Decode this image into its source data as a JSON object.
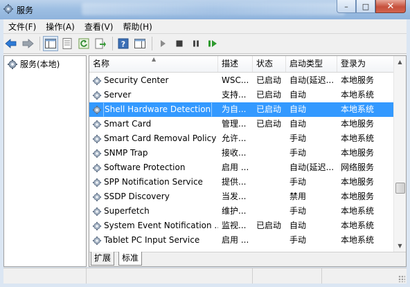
{
  "window": {
    "title": "服务",
    "minimize_glyph": "–",
    "maximize_glyph": "□",
    "close_glyph": "✕"
  },
  "menu": [
    {
      "label": "文件(F)"
    },
    {
      "label": "操作(A)"
    },
    {
      "label": "查看(V)"
    },
    {
      "label": "帮助(H)"
    }
  ],
  "toolbar": [
    {
      "icon": "back-arrow-icon"
    },
    {
      "icon": "forward-arrow-icon"
    },
    {
      "icon": "console-tree-icon"
    },
    {
      "icon": "properties-icon"
    },
    {
      "icon": "refresh-icon"
    },
    {
      "icon": "export-list-icon"
    },
    {
      "icon": "help-icon"
    },
    {
      "icon": "show-hide-action-pane-icon"
    },
    {
      "icon": "start-service-icon"
    },
    {
      "icon": "stop-service-icon"
    },
    {
      "icon": "pause-service-icon"
    },
    {
      "icon": "restart-service-icon"
    }
  ],
  "tree": {
    "root_label": "服务(本地)",
    "icon": "services-gear-icon"
  },
  "columns": [
    {
      "label": "名称",
      "width": 186
    },
    {
      "label": "描述",
      "width": 50
    },
    {
      "label": "状态",
      "width": 48
    },
    {
      "label": "启动类型",
      "width": 74
    },
    {
      "label": "登录为",
      "width": 83
    }
  ],
  "services": [
    {
      "name": "Security Center",
      "desc": "WSC...",
      "status": "已启动",
      "startup": "自动(延迟...",
      "logon": "本地服务",
      "selected": false
    },
    {
      "name": "Server",
      "desc": "支持...",
      "status": "已启动",
      "startup": "自动",
      "logon": "本地系统",
      "selected": false
    },
    {
      "name": "Shell Hardware Detection",
      "desc": "为自...",
      "status": "已启动",
      "startup": "自动",
      "logon": "本地系统",
      "selected": true
    },
    {
      "name": "Smart Card",
      "desc": "管理...",
      "status": "已启动",
      "startup": "自动",
      "logon": "本地服务",
      "selected": false
    },
    {
      "name": "Smart Card Removal Policy",
      "desc": "允许...",
      "status": "",
      "startup": "手动",
      "logon": "本地系统",
      "selected": false
    },
    {
      "name": "SNMP Trap",
      "desc": "接收...",
      "status": "",
      "startup": "手动",
      "logon": "本地服务",
      "selected": false
    },
    {
      "name": "Software Protection",
      "desc": "启用 ...",
      "status": "",
      "startup": "自动(延迟...",
      "logon": "网络服务",
      "selected": false
    },
    {
      "name": "SPP Notification Service",
      "desc": "提供...",
      "status": "",
      "startup": "手动",
      "logon": "本地服务",
      "selected": false
    },
    {
      "name": "SSDP Discovery",
      "desc": "当发...",
      "status": "",
      "startup": "禁用",
      "logon": "本地服务",
      "selected": false
    },
    {
      "name": "Superfetch",
      "desc": "维护...",
      "status": "",
      "startup": "手动",
      "logon": "本地系统",
      "selected": false
    },
    {
      "name": "System Event Notification ...",
      "desc": "监视...",
      "status": "已启动",
      "startup": "自动",
      "logon": "本地系统",
      "selected": false
    },
    {
      "name": "Tablet PC Input Service",
      "desc": "启用 ...",
      "status": "",
      "startup": "手动",
      "logon": "本地系统",
      "selected": false
    }
  ],
  "tabs": [
    {
      "label": "扩展",
      "active": false
    },
    {
      "label": "标准",
      "active": true
    }
  ],
  "colors": {
    "selection": "#3399ff",
    "title_bar": "#9ebfe3"
  }
}
